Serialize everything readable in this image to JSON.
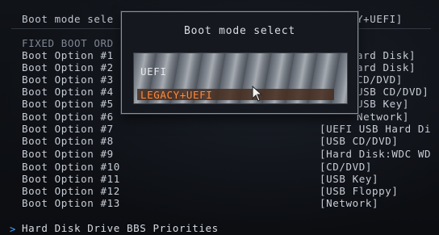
{
  "setting": {
    "label": "Boot mode sele",
    "value": "Y+UEFI]"
  },
  "fixed_header": "FIXED BOOT ORD",
  "options": [
    {
      "label": "Boot Option #1",
      "value": "ard Disk]"
    },
    {
      "label": "Boot Option #2",
      "value": "ard Disk]"
    },
    {
      "label": "Boot Option #3",
      "value": "CD/DVD]"
    },
    {
      "label": "Boot Option #4",
      "value": "USB CD/DVD]"
    },
    {
      "label": "Boot Option #5",
      "value": "USB Key]"
    },
    {
      "label": "Boot Option #6",
      "value": "Network]"
    },
    {
      "label": "Boot Option #7",
      "value": "[UEFI USB Hard Di"
    },
    {
      "label": "Boot Option #8",
      "value": "[USB CD/DVD]"
    },
    {
      "label": "Boot Option #9",
      "value": "[Hard Disk:WDC WD"
    },
    {
      "label": "Boot Option #10",
      "value": "[CD/DVD]"
    },
    {
      "label": "Boot Option #11",
      "value": "[USB Key]"
    },
    {
      "label": "Boot Option #12",
      "value": "[USB Floppy]"
    },
    {
      "label": "Boot Option #13",
      "value": "[Network]"
    }
  ],
  "footer_item": {
    "arrow": ">",
    "label": "Hard Disk Drive BBS Priorities"
  },
  "popup": {
    "title": "Boot mode select",
    "options": [
      "UEFI",
      "LEGACY+UEFI"
    ],
    "selected": "LEGACY+UEFI"
  },
  "colors": {
    "background": "#0c0e12",
    "text": "#c8cdd6",
    "highlight_text": "#ff8a3c",
    "arrow": "#4ea3ff"
  },
  "icons": {
    "pointer": "mouse-pointer-icon",
    "submenu": "submenu-arrow-icon"
  }
}
